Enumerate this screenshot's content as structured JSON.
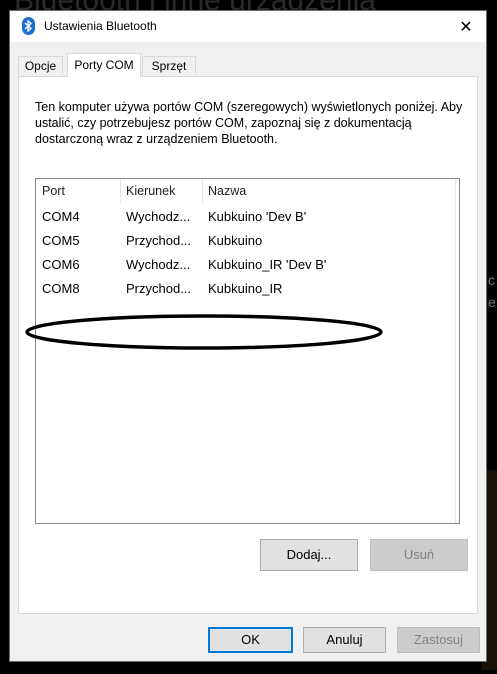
{
  "background": {
    "window_title_fragment": "Bluetooth i inne urządzenia"
  },
  "dialog": {
    "title": "Ustawienia Bluetooth",
    "close_label": "✕",
    "tabs": [
      {
        "label": "Opcje",
        "active": false
      },
      {
        "label": "Porty COM",
        "active": true
      },
      {
        "label": "Sprzęt",
        "active": false
      }
    ],
    "description": "Ten komputer używa portów COM (szeregowych) wyświetlonych poniżej. Aby ustalić, czy potrzebujesz portów COM, zapoznaj się z dokumentacją dostarczoną wraz z urządzeniem Bluetooth.",
    "list": {
      "columns": [
        "Port",
        "Kierunek",
        "Nazwa"
      ],
      "rows": [
        {
          "port": "COM4",
          "direction": "Wychodz...",
          "name": "Kubkuino 'Dev B'"
        },
        {
          "port": "COM5",
          "direction": "Przychod...",
          "name": "Kubkuino"
        },
        {
          "port": "COM6",
          "direction": "Wychodz...",
          "name": "Kubkuino_IR 'Dev B'"
        },
        {
          "port": "COM8",
          "direction": "Przychod...",
          "name": "Kubkuino_IR"
        }
      ],
      "highlight_color": "#000000"
    },
    "buttons": {
      "add": "Dodaj...",
      "remove": "Usuń",
      "ok": "OK",
      "cancel": "Anuluj",
      "apply": "Zastosuj"
    },
    "accent_color": "#0078d7"
  }
}
